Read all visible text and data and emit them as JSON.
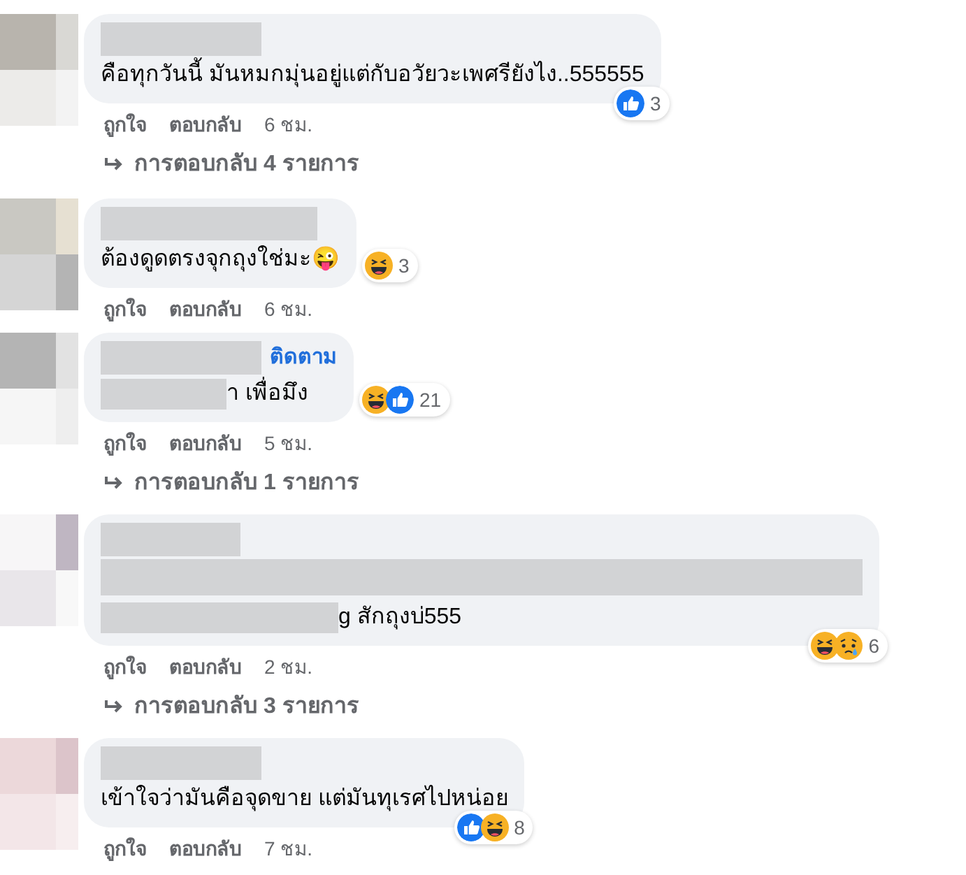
{
  "comments": [
    {
      "kind": "corner",
      "name_redacted": true,
      "text_prefix_redacted": false,
      "redacted_line": false,
      "text": "คือทุกวันนี้ มันหมกมุ่นอยู่แต่กับอวัยวะเพศรียังไง..555555",
      "reactions": [
        {
          "kind": "like"
        }
      ],
      "reaction_count": "3",
      "like": "ถูกใจ",
      "reply": "ตอบกลับ",
      "time": "6 ชม.",
      "replies_link": "การตอบกลับ 4 รายการ"
    },
    {
      "kind": "side",
      "name_redacted": true,
      "text_prefix_redacted": false,
      "redacted_line": false,
      "text": "ต้องดูดตรงจุกถุงใช่มะ😜",
      "reactions": [
        {
          "kind": "haha"
        }
      ],
      "reaction_count": "3",
      "like": "ถูกใจ",
      "reply": "ตอบกลับ",
      "time": "6 ชม."
    },
    {
      "kind": "side",
      "name_redacted": true,
      "follow": "ติดตาม",
      "text_prefix_redacted": true,
      "redacted_line": false,
      "text": "า เพื่อมึง",
      "reactions": [
        {
          "kind": "haha"
        },
        {
          "kind": "like"
        }
      ],
      "reaction_count": "21",
      "like": "ถูกใจ",
      "reply": "ตอบกลับ",
      "time": "5 ชม.",
      "replies_link": "การตอบกลับ 1 รายการ"
    },
    {
      "kind": "corner",
      "name_redacted": true,
      "text_prefix_redacted": true,
      "redacted_line": true,
      "text": "g สักถุงบ่555",
      "reactions": [
        {
          "kind": "haha"
        },
        {
          "kind": "sad"
        }
      ],
      "reaction_count": "6",
      "like": "ถูกใจ",
      "reply": "ตอบกลับ",
      "time": "2 ชม.",
      "replies_link": "การตอบกลับ 3 รายการ"
    },
    {
      "kind": "corner",
      "name_redacted": true,
      "text_prefix_redacted": false,
      "redacted_line": false,
      "text": "เข้าใจว่ามันคือจุดขาย แต่มันทุเรศไปหน่อย",
      "reactions": [
        {
          "kind": "like"
        },
        {
          "kind": "haha"
        }
      ],
      "reaction_count": "8",
      "like": "ถูกใจ",
      "reply": "ตอบกลับ",
      "time": "7 ชม."
    }
  ]
}
